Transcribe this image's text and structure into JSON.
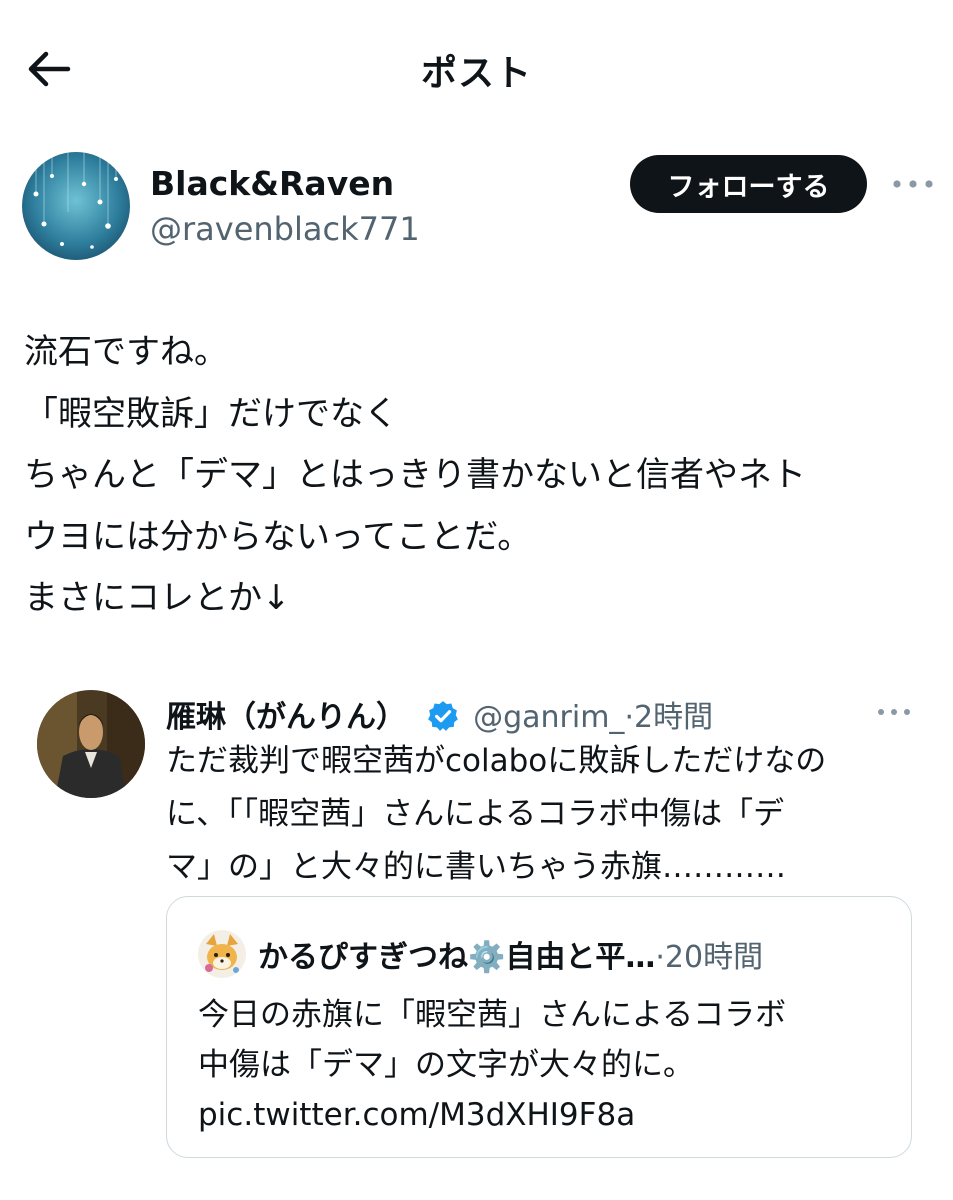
{
  "header": {
    "title": "ポスト"
  },
  "author": {
    "name": "Black&Raven",
    "handle": "@ravenblack771",
    "follow_label": "フォローする"
  },
  "post": {
    "lines": [
      "流石ですね。",
      "「暇空敗訴」だけでなく",
      "ちゃんと「デマ」とはっきり書かないと信者やネト",
      "ウヨには分からないってことだ。",
      "まさにコレとか↓"
    ]
  },
  "quoted": {
    "name": "雁琳（がんりん）",
    "handle": "@ganrim_",
    "dot": "·",
    "time": "2時間",
    "lines": [
      "ただ裁判で暇空茜がcolaboに敗訴しただけなの",
      "に、「「暇空茜」さんによるコラボ中傷は「デ",
      "マ」の」と大々的に書いちゃう赤旗…………"
    ],
    "nested": {
      "name": "かるぴすぎつね⚙️自由と平…",
      "dot": "·",
      "time": "20時間",
      "lines": [
        "今日の赤旗に「暇空茜」さんによるコラボ",
        "中傷は「デマ」の文字が大々的に。",
        "pic.twitter.com/M3dXHI9F8a"
      ]
    }
  },
  "icons": {
    "back": "back-arrow-icon",
    "more": "more-dots-icon",
    "verified": "verified-badge-icon"
  },
  "colors": {
    "text": "#0f1419",
    "secondary": "#536471",
    "follow_bg": "#0f1419",
    "verified": "#1d9bf0",
    "border": "#cfd9de"
  }
}
